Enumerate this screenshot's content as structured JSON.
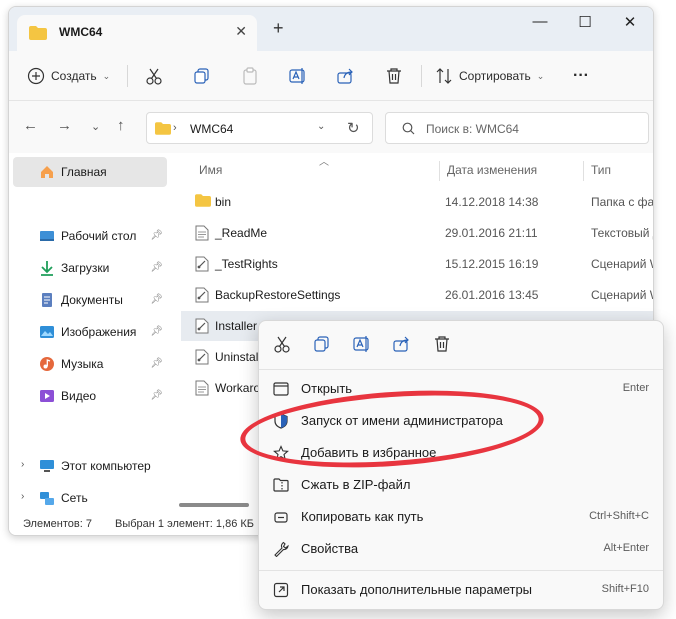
{
  "window": {
    "tab_title": "WMC64",
    "new_tab": "+",
    "close_tab": "✕",
    "minimize": "—",
    "maximize": "☐",
    "close": "✕"
  },
  "commandbar": {
    "new_label": "Создать",
    "sort_label": "Сортировать",
    "more": "···"
  },
  "address": {
    "path_sep": "›",
    "path": "WMC64",
    "search_placeholder": "Поиск в: WMC64"
  },
  "sidebar": {
    "home": "Главная",
    "quick": [
      {
        "label": "Рабочий стол",
        "icon": "desktop-icon"
      },
      {
        "label": "Загрузки",
        "icon": "downloads-icon"
      },
      {
        "label": "Документы",
        "icon": "documents-icon"
      },
      {
        "label": "Изображения",
        "icon": "pictures-icon"
      },
      {
        "label": "Музыка",
        "icon": "music-icon"
      },
      {
        "label": "Видео",
        "icon": "video-icon"
      }
    ],
    "this_pc": "Этот компьютер",
    "network": "Сеть"
  },
  "columns": {
    "name": "Имя",
    "date": "Дата изменения",
    "type": "Тип"
  },
  "files": [
    {
      "name": "bin",
      "date": "14.12.2018 14:38",
      "type": "Папка с фа",
      "icon": "folder-icon"
    },
    {
      "name": "_ReadMe",
      "date": "29.01.2016 21:11",
      "type": "Текстовый д",
      "icon": "text-file-icon"
    },
    {
      "name": "_TestRights",
      "date": "15.12.2015 16:19",
      "type": "Сценарий W",
      "icon": "script-file-icon"
    },
    {
      "name": "BackupRestoreSettings",
      "date": "26.01.2016 13:45",
      "type": "Сценарий W",
      "icon": "script-file-icon"
    },
    {
      "name": "Installer",
      "date": "",
      "type": "",
      "icon": "script-file-icon"
    },
    {
      "name": "Uninstaller",
      "date": "",
      "type": "",
      "icon": "script-file-icon"
    },
    {
      "name": "Workarou",
      "date": "",
      "type": "",
      "icon": "text-file-icon"
    }
  ],
  "status": {
    "count": "Элементов: 7",
    "selected": "Выбран 1 элемент: 1,86 КБ"
  },
  "context_menu": {
    "items": [
      {
        "label": "Открыть",
        "shortcut": "Enter",
        "icon": "open-icon"
      },
      {
        "label": "Запуск от имени администратора",
        "shortcut": "",
        "icon": "shield-icon"
      },
      {
        "label": "Добавить в избранное",
        "shortcut": "",
        "icon": "star-icon"
      },
      {
        "label": "Сжать в ZIP-файл",
        "shortcut": "",
        "icon": "zip-icon"
      },
      {
        "label": "Копировать как путь",
        "shortcut": "Ctrl+Shift+C",
        "icon": "copy-path-icon"
      },
      {
        "label": "Свойства",
        "shortcut": "Alt+Enter",
        "icon": "wrench-icon"
      }
    ],
    "more": {
      "label": "Показать дополнительные параметры",
      "shortcut": "Shift+F10",
      "icon": "more-options-icon"
    }
  },
  "colors": {
    "accent": "#0067c0",
    "folder": "#f4c542",
    "annotation": "#e8353f"
  }
}
